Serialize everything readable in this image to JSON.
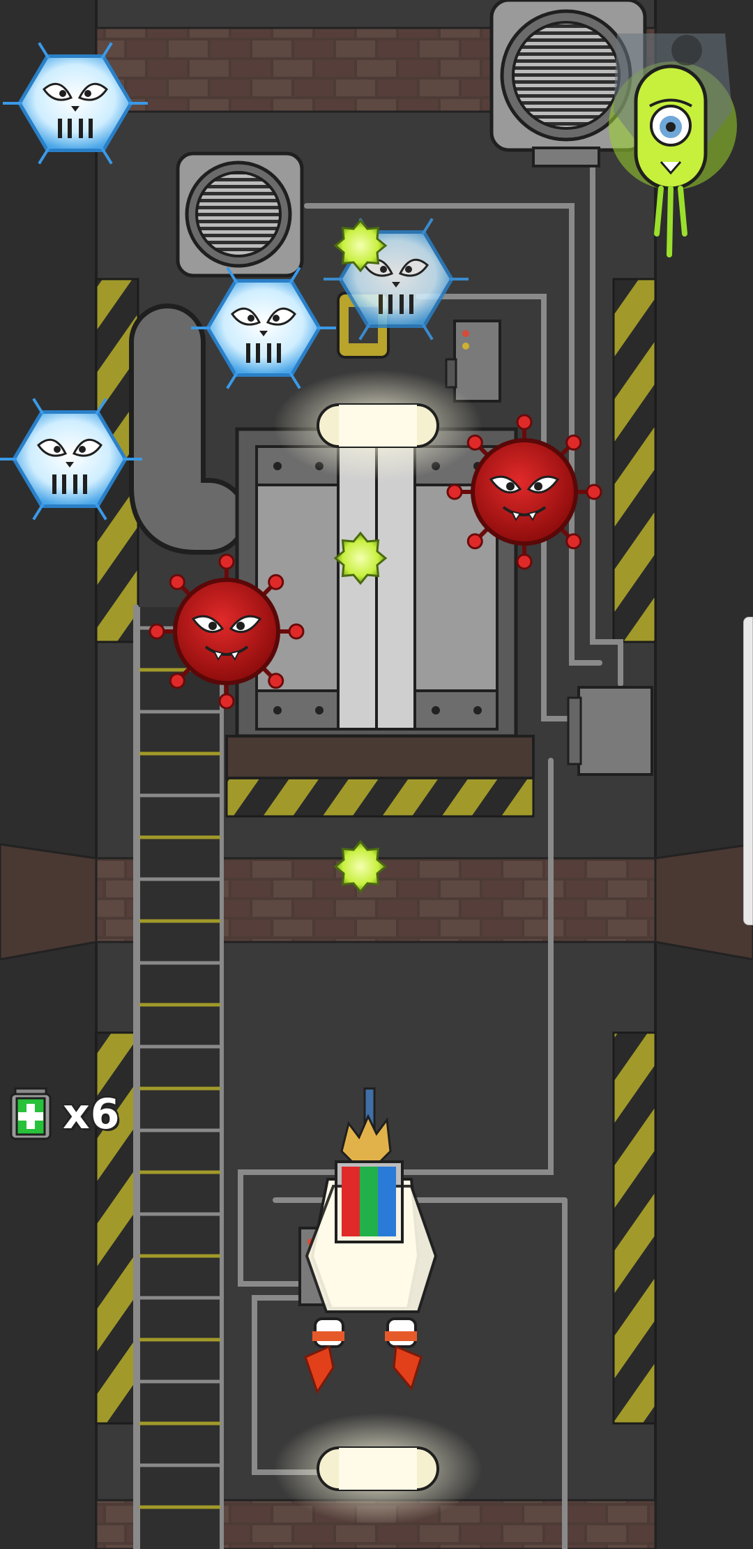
{
  "game": {
    "lives": {
      "icon": "health-kit-icon",
      "count_text": "x6"
    }
  },
  "colors": {
    "background": "#3a3a3a",
    "brick": "#5a4640",
    "hazard_yellow": "#a19a2a",
    "ice_enemy": "#bfe6ff",
    "virus_enemy": "#c81818",
    "projectile": "#c8f040",
    "alien": "#b8f040"
  },
  "entities": {
    "ice_enemies": [
      "ice-virus-enemy",
      "ice-virus-enemy",
      "ice-virus-enemy",
      "ice-virus-enemy"
    ],
    "red_enemies": [
      "red-virus-enemy",
      "red-virus-enemy"
    ],
    "projectiles": [
      "green-energy-shot",
      "green-energy-shot",
      "green-energy-shot"
    ],
    "boss": "green-alien-pod-enemy",
    "player": "scientist-player-character"
  }
}
